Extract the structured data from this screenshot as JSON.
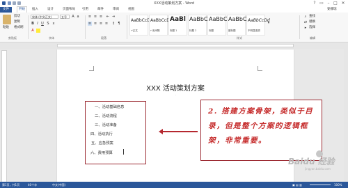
{
  "window": {
    "title": "XXX活动策划方案 - Word",
    "controls": [
      "?",
      "▭",
      "–",
      "□",
      "✕"
    ]
  },
  "ribbon_tabs": {
    "file": "文件",
    "items": [
      "开始",
      "插入",
      "设计",
      "页面布局",
      "引用",
      "邮件",
      "审阅",
      "视图"
    ],
    "account": "安娜瑞"
  },
  "ribbon": {
    "clipboard": {
      "paste": "粘贴",
      "cut": "剪切",
      "copy": "复制",
      "format_painter": "格式刷",
      "label": "剪贴板"
    },
    "font": {
      "family": "宋体 (中文正文)",
      "size": "五号",
      "label": "字体"
    },
    "paragraph": {
      "label": "段落"
    },
    "styles": {
      "label": "样式",
      "items": [
        {
          "sample": "AaBbCcDd",
          "name": "↵正文"
        },
        {
          "sample": "AaBbCcDd",
          "name": "↵无间隔"
        },
        {
          "sample": "AaBl",
          "name": "标题 1"
        },
        {
          "sample": "AaBbC",
          "name": "标题 2"
        },
        {
          "sample": "AaBbC",
          "name": "标题"
        },
        {
          "sample": "AaBbC",
          "name": "副标题"
        },
        {
          "sample": "AaBbCcDd",
          "name": "不明显强调"
        }
      ]
    },
    "editing": {
      "find": "查找",
      "replace": "替换",
      "select": "选择",
      "label": "编辑"
    }
  },
  "document": {
    "title": "XXX 活动策划方案",
    "outline": [
      "一、活动基础信息",
      "二、活动流程",
      "三、活动准备",
      "四、活动执行",
      "五、应急预案",
      "六、费用预算"
    ]
  },
  "annotation": {
    "text": "2. 搭建方案骨架，类似于目录，但是整个方案的逻辑框架，非常重要。"
  },
  "status_bar": {
    "page": "第1页，共1页",
    "words": "40个字",
    "language": "中文(中国)",
    "zoom": "100%"
  },
  "watermark": {
    "text": "Baidu 经验",
    "sub": "jingyan.baidu.com"
  },
  "colors": {
    "accent": "#2b579a",
    "annotation_red": "#c52a2a",
    "box_border": "#9c2b33"
  }
}
